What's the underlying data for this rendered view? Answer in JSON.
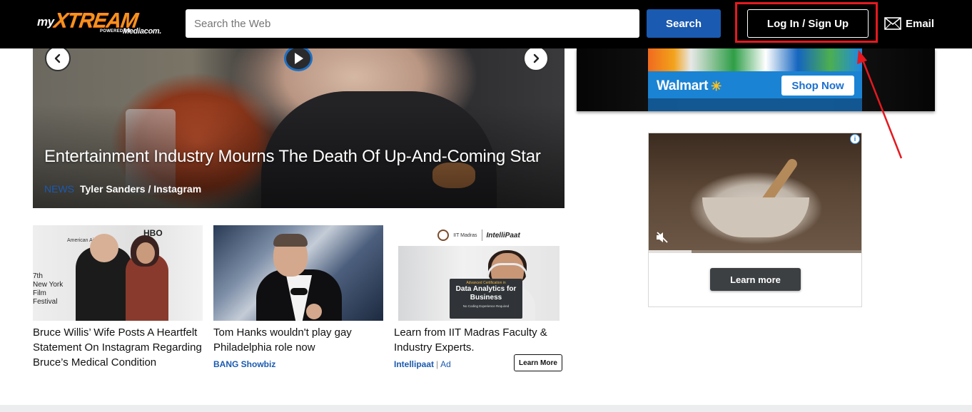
{
  "header": {
    "logo": {
      "my": "my",
      "xtream": "XTREAM",
      "powered_by": "POWERED BY",
      "brand": "Mediacom."
    },
    "search": {
      "placeholder": "Search the Web",
      "value": "",
      "button_label": "Search"
    },
    "login_label": "Log In / Sign Up",
    "email_label": "Email"
  },
  "hero": {
    "title": "Entertainment Industry Mourns The Death Of Up-And-Coming Star",
    "category": "NEWS",
    "credit": "Tyler Sanders / Instagram"
  },
  "ads_right": {
    "top_banner": {
      "brand": "Walmart",
      "cta": "Shop Now"
    },
    "video_ad": {
      "info_glyph": "i",
      "cta": "Learn more",
      "progress": 0.2
    }
  },
  "cards": [
    {
      "title": "Bruce Willis’ Wife Posts A Heartfelt Statement On Instagram Regarding Bruce’s Medical Condition",
      "image_text": {
        "backdrop_lines": [
          "7th",
          "New York",
          "Film",
          "Festival"
        ],
        "hbo": "HBO",
        "airline": "American Airlines"
      }
    },
    {
      "title": "Tom Hanks wouldn't play gay Philadelphia role now",
      "source": "BANG Showbiz"
    },
    {
      "title": "Learn from IIT Madras Faculty & Industry Experts.",
      "sponsor": "Intellipaat",
      "ad_label": "Ad",
      "cta": "Learn More",
      "image_text": {
        "institute": "IIT Madras",
        "partner": "IntelliPaat",
        "board_top": "Advanced Certification in",
        "board_main": "Data Analytics for Business",
        "board_sub": "No Coding Experience Required"
      }
    }
  ],
  "colors": {
    "header_bg": "#000000",
    "search_button": "#1a5ab0",
    "highlight": "#e5191f",
    "logo_accent": "#f6911e",
    "link_blue": "#1a5ab0"
  },
  "icons": {
    "carousel_prev": "chevron-left-icon",
    "carousel_next": "chevron-right-icon",
    "play": "play-icon",
    "email": "envelope-icon",
    "mute": "mute-icon",
    "ad_info": "info-icon"
  }
}
